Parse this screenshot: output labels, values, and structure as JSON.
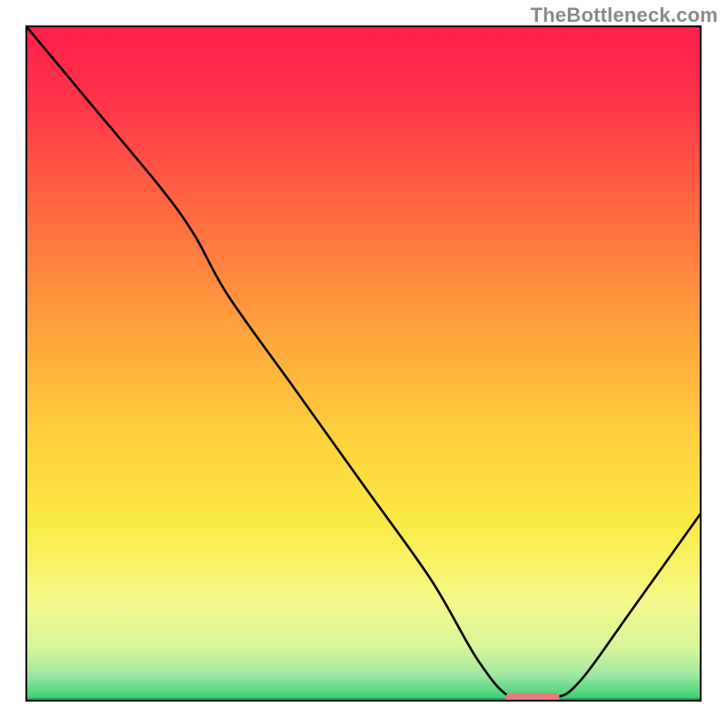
{
  "watermark": "TheBottleneck.com",
  "chart_data": {
    "type": "line",
    "title": "",
    "xlabel": "",
    "ylabel": "",
    "xlim": [
      0,
      100
    ],
    "ylim": [
      0,
      100
    ],
    "grid": false,
    "curve_comment": "Black curve: approximate shape read from image. Starts top-left, slight convex bend, dives to a flat near-zero trough ~x 70-78 (pink marker), then rises to ~y 28 at right edge.",
    "x": [
      0,
      10,
      20,
      25,
      30,
      40,
      50,
      60,
      67,
      72,
      78,
      82,
      90,
      100
    ],
    "values": [
      100,
      88,
      76,
      69,
      60,
      46,
      32,
      18,
      6,
      0.5,
      0.5,
      3,
      14,
      28
    ],
    "marker": {
      "x": 75,
      "y": 0.6,
      "width_x": 8,
      "color": "#E77B7E"
    },
    "gradient_stops": [
      {
        "pct": 0,
        "color": "#FF1E4B"
      },
      {
        "pct": 12,
        "color": "#FF3649"
      },
      {
        "pct": 28,
        "color": "#FF6B3F"
      },
      {
        "pct": 45,
        "color": "#FFA23C"
      },
      {
        "pct": 60,
        "color": "#FFCE3D"
      },
      {
        "pct": 74,
        "color": "#FBEB46"
      },
      {
        "pct": 85,
        "color": "#F6F98A"
      },
      {
        "pct": 92,
        "color": "#D8F59A"
      },
      {
        "pct": 96,
        "color": "#9FE8A1"
      },
      {
        "pct": 100,
        "color": "#2ECC71"
      }
    ]
  }
}
